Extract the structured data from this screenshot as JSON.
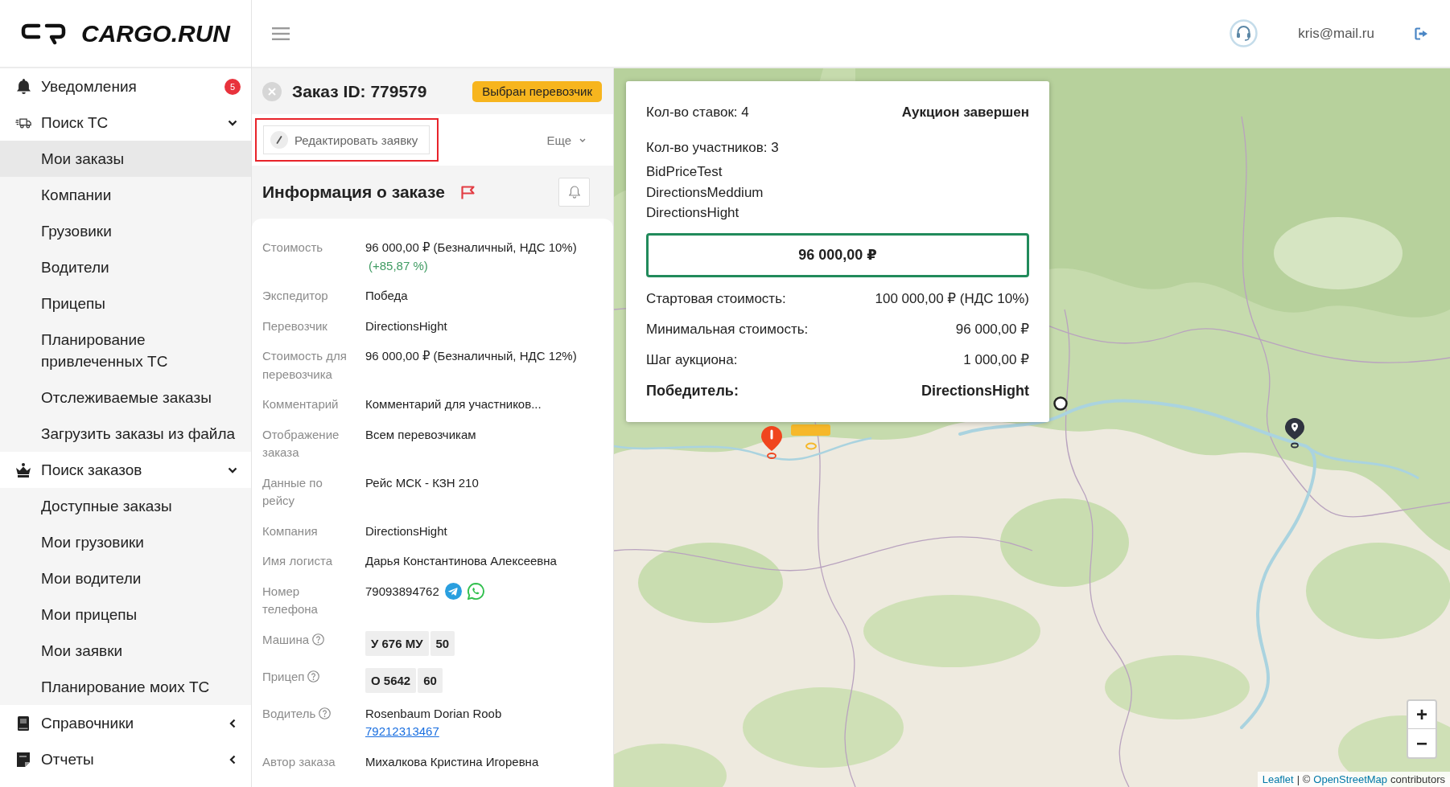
{
  "header": {
    "brand": "CARGO.RUN",
    "user_email": "kris@mail.ru"
  },
  "sidebar": {
    "items": [
      {
        "label": "Уведомления",
        "kind": "link",
        "badge": "5"
      },
      {
        "label": "Поиск ТС",
        "kind": "group",
        "expanded": true,
        "children": [
          {
            "label": "Мои заказы",
            "selected": true
          },
          {
            "label": "Компании",
            "selected": false
          },
          {
            "label": "Грузовики",
            "selected": false
          },
          {
            "label": "Водители",
            "selected": false
          },
          {
            "label": "Прицепы",
            "selected": false
          },
          {
            "label": "Планирование привлеченных ТС",
            "selected": false
          },
          {
            "label": "Отслеживаемые заказы",
            "selected": false
          },
          {
            "label": "Загрузить заказы из файла",
            "selected": false
          }
        ]
      },
      {
        "label": "Поиск заказов",
        "kind": "group",
        "expanded": true,
        "children": [
          {
            "label": "Доступные заказы",
            "selected": false
          },
          {
            "label": "Мои грузовики",
            "selected": false
          },
          {
            "label": "Мои водители",
            "selected": false
          },
          {
            "label": "Мои прицепы",
            "selected": false
          },
          {
            "label": "Мои заявки",
            "selected": false
          },
          {
            "label": "Планирование моих ТС",
            "selected": false
          }
        ]
      },
      {
        "label": "Справочники",
        "kind": "group",
        "expanded": false
      },
      {
        "label": "Отчеты",
        "kind": "group",
        "expanded": false
      }
    ]
  },
  "order": {
    "title": "Заказ ID: 779579",
    "status": "Выбран перевозчик",
    "edit_button": {
      "label": "Редактировать заявку",
      "highlighted": true
    },
    "more_button": "Еще",
    "section_title": "Информация о заказе",
    "fields": [
      {
        "kind": "price",
        "label": "Стоимость",
        "value": "96 000,00 ₽ (Безналичный, НДС 10%)",
        "change": "(+85,87 %)",
        "help": false
      },
      {
        "kind": "text",
        "label": "Экспедитор",
        "value": "Победа",
        "help": false
      },
      {
        "kind": "text",
        "label": "Перевозчик",
        "value": "DirectionsHight",
        "help": false
      },
      {
        "kind": "text",
        "label": "Стоимость для перевозчика",
        "value": "96 000,00 ₽ (Безналичный, НДС 12%)",
        "help": false
      },
      {
        "kind": "text",
        "label": "Комментарий",
        "value": "Комментарий для участников...",
        "help": false
      },
      {
        "kind": "text",
        "label": "Отображение заказа",
        "value": "Всем перевозчикам",
        "help": false
      },
      {
        "kind": "text",
        "label": "Данные по рейсу",
        "value": "Рейс МСК - КЗН 210",
        "help": false
      },
      {
        "kind": "text",
        "label": "Компания",
        "value": "DirectionsHight",
        "help": false
      },
      {
        "kind": "text",
        "label": "Имя логиста",
        "value": "Дарья Константинова Алексеевна",
        "help": false
      },
      {
        "kind": "phone",
        "label": "Номер телефона",
        "value": "79093894762",
        "help": false
      },
      {
        "kind": "plate",
        "label": "Машина",
        "number": "У 676 МУ",
        "region": "50",
        "help": true
      },
      {
        "kind": "plate",
        "label": "Прицеп",
        "number": "О 5642",
        "region": "60",
        "help": true
      },
      {
        "kind": "driver",
        "label": "Водитель",
        "value": "Rosenbaum Dorian Roob",
        "phone": "79212313467",
        "help": true
      },
      {
        "kind": "text",
        "label": "Автор заказа",
        "value": "Михалкова Кристина Игоревна",
        "help": false
      }
    ]
  },
  "map": {
    "auction": {
      "bids_count": "Кол-во ставок: 4",
      "status": "Аукцион завершен",
      "participants_count": "Кол-во участников: 3",
      "participants": [
        "BidPriceTest",
        "DirectionsMeddium",
        "DirectionsHight"
      ],
      "best_price": "96 000,00 ₽",
      "rows": [
        {
          "label": "Стартовая стоимость:",
          "value": "100 000,00 ₽ (НДС 10%)"
        },
        {
          "label": "Минимальная стоимость:",
          "value": "96 000,00 ₽"
        },
        {
          "label": "Шаг аукциона:",
          "value": "1 000,00 ₽"
        }
      ],
      "winner": {
        "label": "Победитель:",
        "value": "DirectionsHight"
      }
    },
    "zoom_in": "+",
    "zoom_out": "−",
    "attribution": [
      {
        "kind": "link",
        "text": "Leaflet"
      },
      {
        "kind": "text",
        "text": "| ©"
      },
      {
        "kind": "link",
        "text": "OpenStreetMap"
      },
      {
        "kind": "text",
        "text": "contributors"
      }
    ]
  }
}
